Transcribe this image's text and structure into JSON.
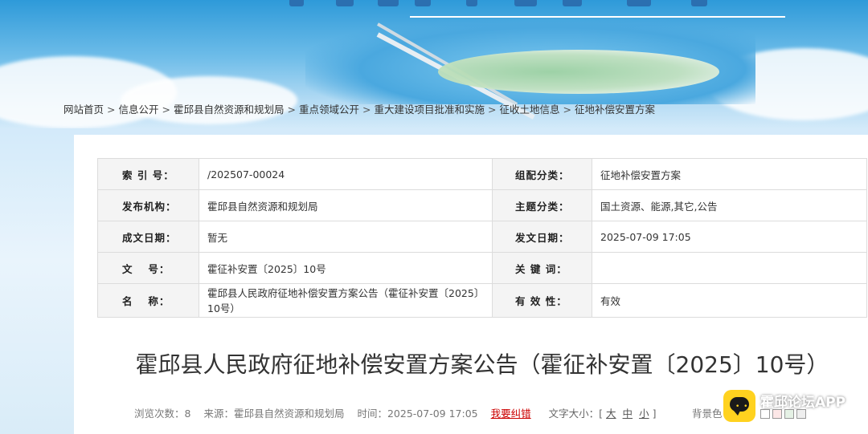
{
  "breadcrumb": [
    "网站首页",
    "信息公开",
    "霍邱县自然资源和规划局",
    "重点领域公开",
    "重大建设项目批准和实施",
    "征收土地信息",
    "征地补偿安置方案"
  ],
  "breadcrumb_sep": ">",
  "meta": {
    "index_label": "索 引 号：",
    "index_value": "/202507-00024",
    "category_label": "组配分类：",
    "category_value": "征地补偿安置方案",
    "publisher_label": "发布机构：",
    "publisher_value": "霍邱县自然资源和规划局",
    "topic_label": "主题分类：",
    "topic_value": "国土资源、能源,其它,公告",
    "created_label": "成文日期：",
    "created_value": "暂无",
    "published_label": "发文日期：",
    "published_value": "2025-07-09 17:05",
    "docno_label": "文　 号：",
    "docno_value": "霍征补安置〔2025〕10号",
    "keywords_label": "关 键 词：",
    "keywords_value": "",
    "name_label": "名　 称：",
    "name_value": "霍邱县人民政府征地补偿安置方案公告（霍征补安置〔2025〕10号）",
    "validity_label": "有 效 性：",
    "validity_value": "有效"
  },
  "document": {
    "title": "霍邱县人民政府征地补偿安置方案公告（霍征补安置〔2025〕10号）"
  },
  "info": {
    "views_label": "浏览次数：",
    "views": "8",
    "source_label": "来源：霍邱县自然资源和规划局",
    "time_label": "时间：2025-07-09 17:05",
    "report_error": "我要纠错",
    "font_size_label": "文字大小：[",
    "font_large": "大",
    "font_medium": "中",
    "font_small": "小",
    "font_size_end": "]",
    "bg_label": "背景色"
  },
  "watermark": {
    "text": "霍邱论坛APP",
    "icon": "chat-bubble-icon",
    "brand_color": "#ffd21f"
  },
  "colors": {
    "error_link": "#cc0000",
    "banner_blue": "#2e9ad9"
  }
}
